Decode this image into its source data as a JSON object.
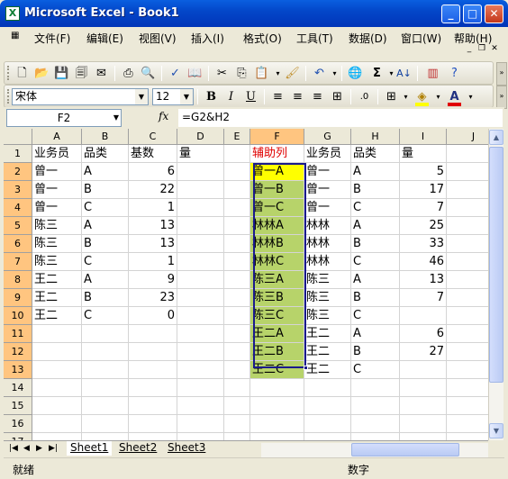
{
  "window": {
    "title": "Microsoft Excel - Book1",
    "minimize": "_",
    "maximize": "□",
    "close": "✕"
  },
  "menu": [
    {
      "label": "文件(F)"
    },
    {
      "label": "编辑(E)"
    },
    {
      "label": "视图(V)"
    },
    {
      "label": "插入(I)"
    },
    {
      "label": "格式(O)"
    },
    {
      "label": "工具(T)"
    },
    {
      "label": "数据(D)"
    },
    {
      "label": "窗口(W)"
    },
    {
      "label": "帮助(H)"
    }
  ],
  "toolbar": {
    "font": "宋体",
    "size": "12",
    "bold": "B",
    "italic": "I",
    "underline": "U",
    "sum": "Σ"
  },
  "formula_bar": {
    "name_box": "F2",
    "fx": "fx",
    "formula": "=G2&H2"
  },
  "columns": [
    "A",
    "B",
    "C",
    "D",
    "E",
    "F",
    "G",
    "H",
    "I",
    "J"
  ],
  "rows": [
    "1",
    "2",
    "3",
    "4",
    "5",
    "6",
    "7",
    "8",
    "9",
    "10",
    "11",
    "12",
    "13",
    "14",
    "15",
    "16",
    "17"
  ],
  "cells": {
    "A": [
      "业务员",
      "曾一",
      "曾一",
      "曾一",
      "陈三",
      "陈三",
      "陈三",
      "王二",
      "王二",
      "王二",
      "",
      "",
      ""
    ],
    "B": [
      "品类",
      "A",
      "B",
      "C",
      "A",
      "B",
      "C",
      "A",
      "B",
      "C",
      "",
      "",
      ""
    ],
    "C": [
      "基数",
      "6",
      "22",
      "1",
      "13",
      "13",
      "1",
      "9",
      "23",
      "0",
      "",
      "",
      ""
    ],
    "D": [
      "量",
      "",
      "",
      "",
      "",
      "",
      "",
      "",
      "",
      "",
      "",
      "",
      ""
    ],
    "F": [
      "辅助列",
      "曾一A",
      "曾一B",
      "曾一C",
      "林林A",
      "林林B",
      "林林C",
      "陈三A",
      "陈三B",
      "陈三C",
      "王二A",
      "王二B",
      "王二C"
    ],
    "G": [
      "业务员",
      "曾一",
      "曾一",
      "曾一",
      "林林",
      "林林",
      "林林",
      "陈三",
      "陈三",
      "陈三",
      "王二",
      "王二",
      "王二"
    ],
    "H": [
      "品类",
      "A",
      "B",
      "C",
      "A",
      "B",
      "C",
      "A",
      "B",
      "C",
      "A",
      "B",
      "C"
    ],
    "I": [
      "量",
      "5",
      "17",
      "7",
      "25",
      "33",
      "46",
      "13",
      "7",
      "",
      "6",
      "27",
      ""
    ]
  },
  "sheets": [
    "Sheet1",
    "Sheet2",
    "Sheet3"
  ],
  "active_sheet": "Sheet1",
  "status": {
    "left": "就绪",
    "mode": "数字"
  },
  "colors": {
    "title_blue": "#0347c9",
    "selection_fill": "#b7d36a",
    "active_fill": "#ffff00",
    "header_text_red": "#e00000"
  }
}
